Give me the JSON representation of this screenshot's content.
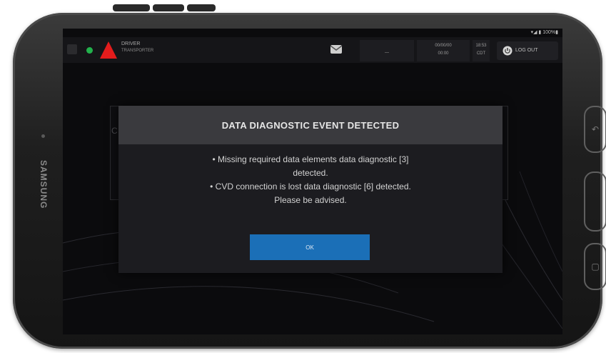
{
  "device": {
    "brand": "SAMSUNG"
  },
  "system_status": {
    "text": "▾◢ ▮ 100%▮"
  },
  "app_bar": {
    "driver_label": "DRIVER",
    "driver_name": "TRANSPORTER",
    "cell_a_text": "",
    "cell_a_sub": "—",
    "cell_b_top": "00/00/00",
    "cell_b_bottom": "00:00",
    "cell_c_top": "18:53",
    "cell_c_bottom": "CDT",
    "logout_label": "LOG OUT"
  },
  "background": {
    "letter": "C"
  },
  "dialog": {
    "title": "DATA DIAGNOSTIC EVENT DETECTED",
    "line1": "• Missing required data elements data diagnostic [3]",
    "line2": "detected.",
    "line3": "• CVD connection is lost data diagnostic [6] detected.",
    "line4": "Please be advised.",
    "ok_label": "OK"
  },
  "colors": {
    "status_ok": "#22b14c",
    "warning": "#e31c1c",
    "primary_button": "#1b6fb7"
  },
  "icons": {
    "menu": "menu-icon",
    "status": "status-dot",
    "warning": "warning-triangle-icon",
    "mail": "mail-icon",
    "logout": "power-icon",
    "back": "back-icon",
    "home": "home-icon",
    "recent": "recent-apps-icon"
  }
}
